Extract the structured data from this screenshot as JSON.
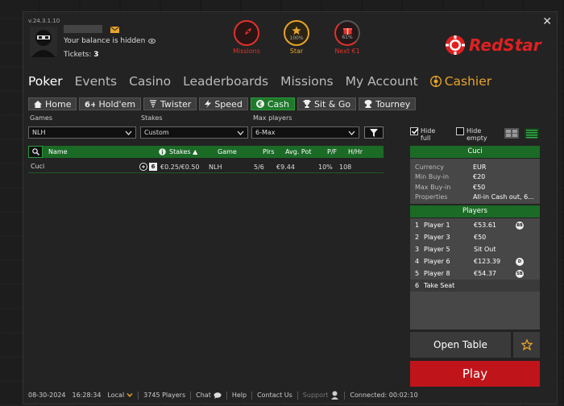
{
  "app": {
    "version": "v.24.3.1.10",
    "brand": "RedStar",
    "brand_color": "#e02020",
    "accent": "#1e7a2b"
  },
  "account": {
    "balance_text": "Your balance is hidden",
    "tickets_label": "Tickets:",
    "tickets_value": "3"
  },
  "top_icons": [
    {
      "name": "missions",
      "label": "Missions",
      "color": "#e0322b",
      "icon": "rocket-icon"
    },
    {
      "name": "star",
      "label": "Star",
      "sub": "100%",
      "color": "#e6a428",
      "icon": "star-icon"
    },
    {
      "name": "next",
      "label": "Next €1",
      "sub": "61%",
      "color": "#e0322b",
      "icon": "gift-icon"
    }
  ],
  "main_nav": [
    "Poker",
    "Events",
    "Casino",
    "Leaderboards",
    "Missions",
    "My Account",
    "Cashier"
  ],
  "sub_nav": [
    {
      "label": "Home",
      "icon": "home-icon"
    },
    {
      "label": "Hold'em",
      "icon": "holdem-icon"
    },
    {
      "label": "Twister",
      "icon": "twister-icon"
    },
    {
      "label": "Speed",
      "icon": "lightning-icon"
    },
    {
      "label": "Cash",
      "icon": "euro-icon"
    },
    {
      "label": "Sit & Go",
      "icon": "trophy-icon"
    },
    {
      "label": "Tourney",
      "icon": "cup-icon"
    }
  ],
  "filters": {
    "games_label": "Games",
    "games_value": "NLH",
    "stakes_label": "Stakes",
    "stakes_value": "Custom",
    "max_label": "Max players",
    "max_value": "6-Max"
  },
  "table": {
    "headers": {
      "name": "Name",
      "stakes": "Stakes ▲",
      "game": "Game",
      "plrs": "Plrs",
      "avg": "Avg. Pot",
      "pf": "P/F",
      "hhr": "H/Hr"
    },
    "rows": [
      {
        "name": "Cuci",
        "seats_badge": "6",
        "stakes": "€0.25/€0.50",
        "game": "NLH",
        "plrs": "5/6",
        "avg": "€9.44",
        "pf": "10%",
        "hhr": "108"
      }
    ]
  },
  "options": {
    "hide_full": "Hide full",
    "hide_empty": "Hide empty"
  },
  "detail": {
    "title": "Cuci",
    "props": [
      {
        "k": "Currency",
        "v": "EUR"
      },
      {
        "k": "Min Buy-in",
        "v": "€20"
      },
      {
        "k": "Max Buy-in",
        "v": "€50"
      },
      {
        "k": "Properties",
        "v": "All-in Cash out, 6..."
      }
    ]
  },
  "players": {
    "title": "Players",
    "rows": [
      {
        "n": "1",
        "name": "Player 1",
        "amt": "€53.61",
        "badge": "BB"
      },
      {
        "n": "2",
        "name": "Player 3",
        "amt": "€50",
        "badge": ""
      },
      {
        "n": "3",
        "name": "Player 5",
        "amt": "Sit Out",
        "badge": ""
      },
      {
        "n": "4",
        "name": "Player 6",
        "amt": "€123.39",
        "badge": "D"
      },
      {
        "n": "5",
        "name": "Player 8",
        "amt": "€54.37",
        "badge": "SB"
      }
    ],
    "take_seat": {
      "n": "6",
      "label": "Take Seat"
    }
  },
  "buttons": {
    "open_table": "Open Table",
    "play": "Play"
  },
  "status": {
    "date": "08-30-2024",
    "time": "16:28:34",
    "tz": "Local",
    "players": "3745 Players",
    "chat": "Chat",
    "help": "Help",
    "contact": "Contact Us",
    "support": "Support",
    "connected": "Connected: 00:02:10"
  }
}
